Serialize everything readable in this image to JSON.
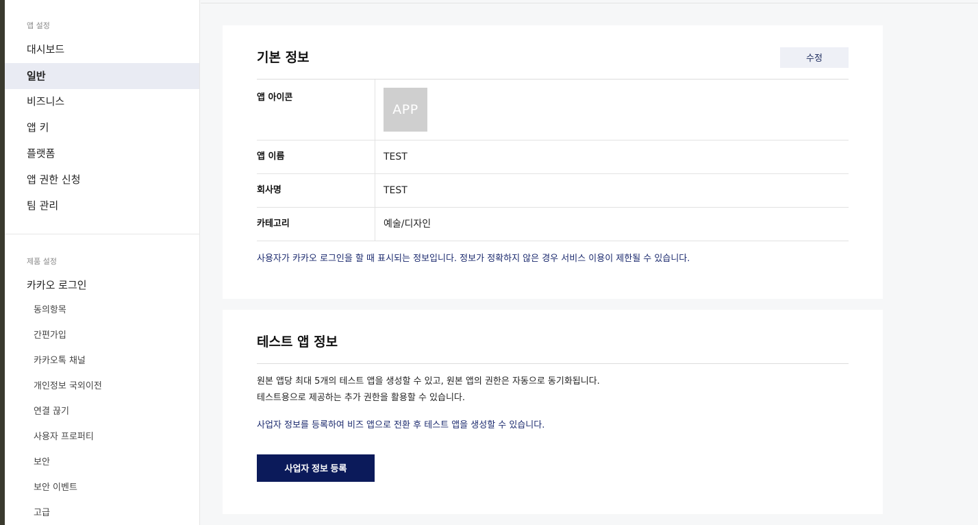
{
  "sidebar": {
    "app_section_label": "앱 설정",
    "app_items": [
      {
        "label": "대시보드"
      },
      {
        "label": "일반",
        "active": true
      },
      {
        "label": "비즈니스"
      },
      {
        "label": "앱 키"
      },
      {
        "label": "플랫폼"
      },
      {
        "label": "앱 권한 신청"
      },
      {
        "label": "팀 관리"
      }
    ],
    "product_section_label": "제품 설정",
    "product_group_label": "카카오 로그인",
    "product_sub_items": [
      {
        "label": "동의항목"
      },
      {
        "label": "간편가입"
      },
      {
        "label": "카카오톡 채널"
      },
      {
        "label": "개인정보 국외이전"
      },
      {
        "label": "연결 끊기"
      },
      {
        "label": "사용자 프로퍼티"
      },
      {
        "label": "보안"
      },
      {
        "label": "보안 이벤트"
      },
      {
        "label": "고급"
      }
    ]
  },
  "basic_info": {
    "title": "기본 정보",
    "edit_label": "수정",
    "rows": {
      "icon_label": "앱 아이콘",
      "icon_text": "APP",
      "name_label": "앱 이름",
      "name_value": "TEST",
      "company_label": "회사명",
      "company_value": "TEST",
      "category_label": "카테고리",
      "category_value": "예술/디자인"
    },
    "notice": "사용자가 카카오 로그인을 할 때 표시되는 정보입니다. 정보가 정확하지 않은 경우 서비스 이용이 제한될 수 있습니다."
  },
  "test_app": {
    "title": "테스트 앱 정보",
    "desc_line1": "원본 앱당 최대 5개의 테스트 앱을 생성할 수 있고, 원본 앱의 권한은 자동으로 동기화됩니다.",
    "desc_line2": "테스트용으로 제공하는 추가 권한을 활용할 수 있습니다.",
    "notice": "사업자 정보를 등록하여 비즈 앱으로 전환 후 테스트 앱을 생성할 수 있습니다.",
    "register_label": "사업자 정보 등록"
  },
  "colors": {
    "accent": "#0b1a5a",
    "notice_text": "#1b2a6e",
    "active_bg": "#e9ebf3"
  }
}
